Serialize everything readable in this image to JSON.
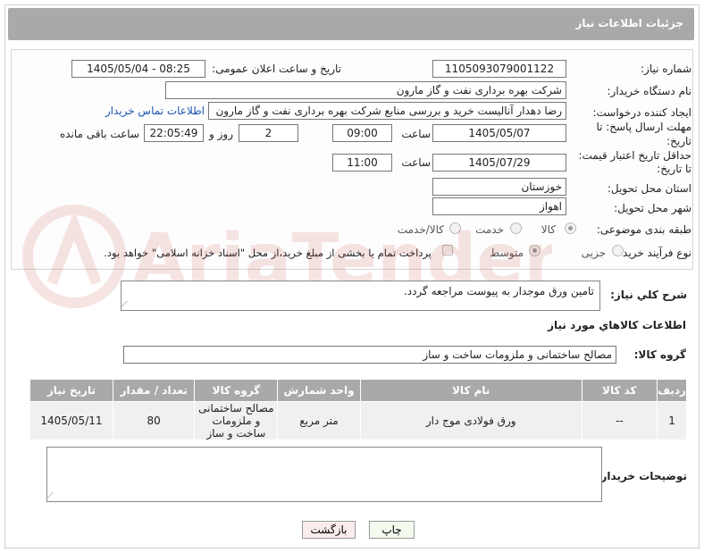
{
  "header": {
    "title": "جزئیات اطلاعات نیاز"
  },
  "form": {
    "need_number_label": "شماره نیاز:",
    "need_number": "1105093079001122",
    "announce_label": "تاریخ و ساعت اعلان عمومی:",
    "announce_value": "1405/05/04 - 08:25",
    "buyer_org_label": "نام دستگاه خریدار:",
    "buyer_org": "شرکت بهره برداری نفت و گاز مارون",
    "creator_label": "ایجاد کننده درخواست:",
    "creator": "رضا دهدار آنالیست خرید و بررسی منابع شرکت بهره برداری نفت و گاز مارون",
    "contact_link": "اطلاعات تماس خریدار",
    "deadline_label_1": "مهلت ارسال پاسخ: تا",
    "deadline_label_2": "تاریخ:",
    "deadline_date": "1405/05/07",
    "time_label": "ساعت",
    "deadline_time": "09:00",
    "days_value": "2",
    "days_label": "روز و",
    "remaining_time": "22:05:49",
    "remaining_label": "ساعت باقی مانده",
    "price_valid_label_1": "حداقل تاریخ اعتبار قیمت:",
    "price_valid_label_2": "تا تاریخ:",
    "price_valid_date": "1405/07/29",
    "price_valid_time_label": "ساعت",
    "price_valid_time": "11:00",
    "province_label": "استان محل تحویل:",
    "province": "خوزستان",
    "city_label": "شهر محل تحویل:",
    "city": "اهواز",
    "category_label": "طبقه بندی موضوعی:",
    "category_options": [
      "کالا",
      "خدمت",
      "کالا/خدمت"
    ],
    "category_selected": "کالا",
    "process_label": "نوع فرآیند خرید :",
    "process_options": [
      "جزیی",
      "متوسط"
    ],
    "process_selected": "متوسط",
    "payment_note": "پرداخت تمام یا بخشی از مبلغ خرید،از محل \"اسناد خزانه اسلامی\" خواهد بود."
  },
  "description": {
    "label": "شرح كلي نياز:",
    "text": "تامین ورق موجدار به پیوست مراجعه گردد."
  },
  "goods": {
    "section_title": "اطلاعات كالاهاي مورد نياز",
    "group_label": "گروه كالا:",
    "group_value": "مصالح ساختمانی و ملزومات ساخت و ساز",
    "columns": [
      "رديف",
      "کد کالا",
      "نام کالا",
      "واحد شمارش",
      "گروه کالا",
      "تعداد / مقدار",
      "تاریخ نیاز"
    ],
    "rows": [
      {
        "row": "1",
        "code": "--",
        "name": "ورق فولادی موج دار",
        "unit": "متر مربع",
        "group": "مصالح ساختمانی و ملزومات ساخت و ساز",
        "qty": "80",
        "date": "1405/05/11"
      }
    ]
  },
  "buyer_notes": {
    "label": "توضیحات خریدار:",
    "text": ""
  },
  "buttons": {
    "print": "چاپ",
    "back": "بازگشت"
  },
  "watermark": {
    "text": "AriaTender.net"
  },
  "colors": {
    "header_bg": "#a9a9a9",
    "link": "#1a55b3",
    "print_bg": "#f3faee",
    "back_bg": "#fbecec"
  }
}
